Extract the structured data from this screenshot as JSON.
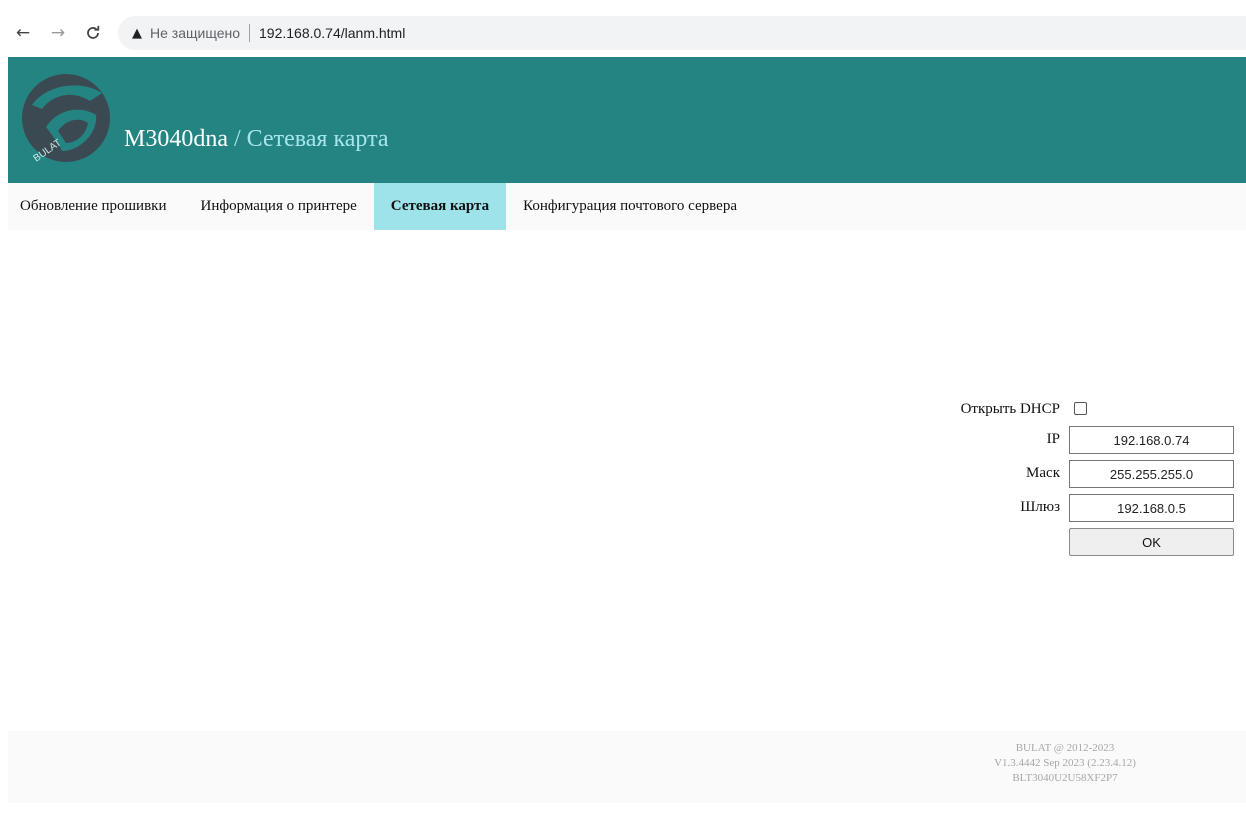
{
  "browser": {
    "security_label": "Не защищено",
    "url": "192.168.0.74/lanm.html",
    "icons": [
      "back-arrow-icon",
      "forward-arrow-icon",
      "reload-icon",
      "warning-icon"
    ]
  },
  "header": {
    "logo_text": "BULAT",
    "model": "M3040dna",
    "separator": " / ",
    "section": "Сетевая карта",
    "bg_color": "#248482"
  },
  "menu": {
    "items": [
      {
        "label": "Обновление прошивки",
        "active": false
      },
      {
        "label": "Информация о принтере",
        "active": false
      },
      {
        "label": "Сетевая карта",
        "active": true
      },
      {
        "label": "Конфигурация почтового сервера",
        "active": false
      }
    ],
    "active_color": "#9ee3ea"
  },
  "form": {
    "dhcp_label": "Открыть DHCP",
    "dhcp_checked": false,
    "ip_label": "IP",
    "ip_value": "192.168.0.74",
    "mask_label": "Маск",
    "mask_value": "255.255.255.0",
    "gateway_label": "Шлюз",
    "gateway_value": "192.168.0.5",
    "ok_label": "OK"
  },
  "footer": {
    "line1": "BULAT @ 2012-2023",
    "line2": "V1.3.4442 Sep 2023 (2.23.4.12)",
    "line3": "BLT3040U2U58XF2P7"
  }
}
